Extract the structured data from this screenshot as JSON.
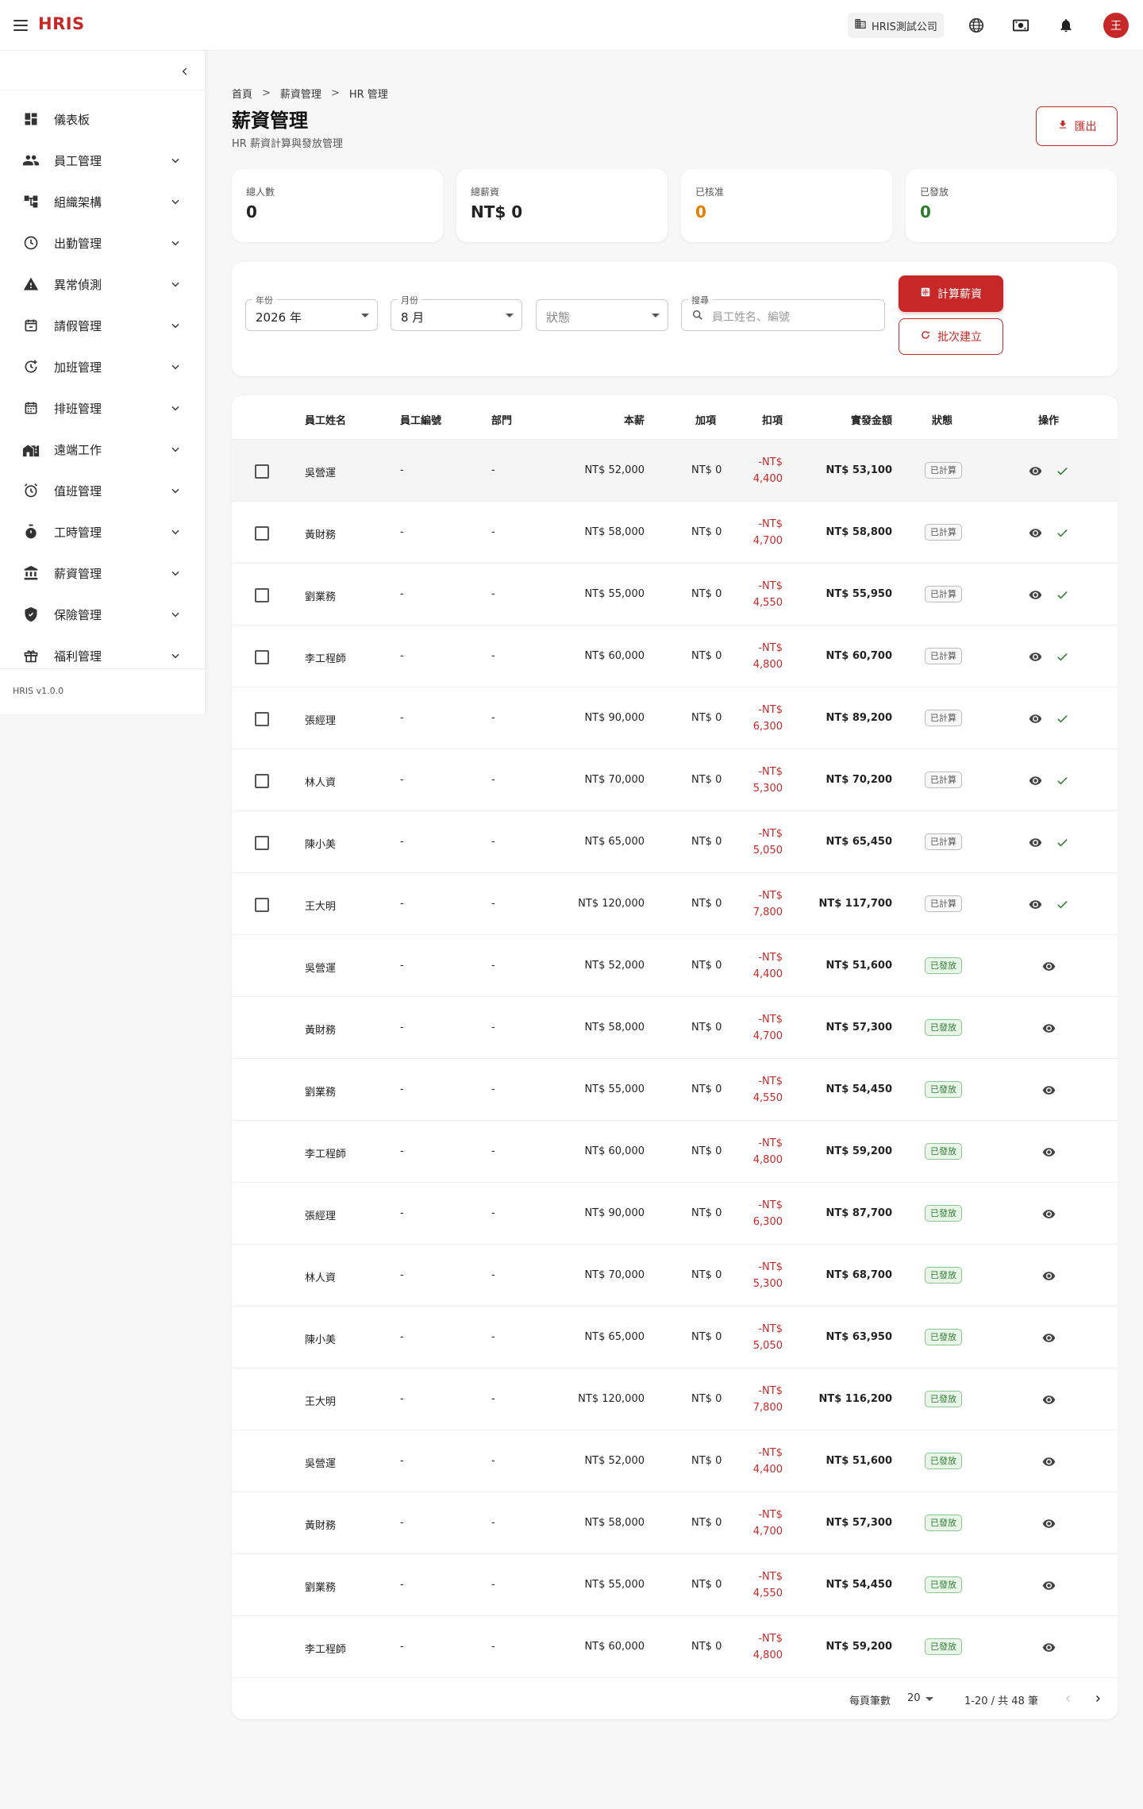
{
  "app": {
    "logo": "HRIS",
    "company": "HRIS測試公司",
    "avatar_initial": "王",
    "version": "HRIS v1.0.0",
    "accent": "#c62828"
  },
  "topbar_icons": [
    "menu-icon",
    "building-icon",
    "globe-icon",
    "currency-icon",
    "bell-icon"
  ],
  "sidebar": {
    "items": [
      {
        "label": "儀表板",
        "icon": "dashboard-icon",
        "expandable": false
      },
      {
        "label": "員工管理",
        "icon": "people-icon",
        "expandable": true
      },
      {
        "label": "組織架構",
        "icon": "org-chart-icon",
        "expandable": true
      },
      {
        "label": "出勤管理",
        "icon": "clock-icon",
        "expandable": true
      },
      {
        "label": "異常偵測",
        "icon": "warning-icon",
        "expandable": true
      },
      {
        "label": "請假管理",
        "icon": "calendar-leave-icon",
        "expandable": true
      },
      {
        "label": "加班管理",
        "icon": "overtime-icon",
        "expandable": true
      },
      {
        "label": "排班管理",
        "icon": "schedule-icon",
        "expandable": true
      },
      {
        "label": "遠端工作",
        "icon": "home-work-icon",
        "expandable": true
      },
      {
        "label": "值班管理",
        "icon": "alarm-icon",
        "expandable": true
      },
      {
        "label": "工時管理",
        "icon": "timer-icon",
        "expandable": true
      },
      {
        "label": "薪資管理",
        "icon": "bank-icon",
        "expandable": true
      },
      {
        "label": "保險管理",
        "icon": "shield-icon",
        "expandable": true
      },
      {
        "label": "福利管理",
        "icon": "gift-icon",
        "expandable": true
      }
    ]
  },
  "breadcrumb": {
    "items": [
      "首頁",
      "薪資管理",
      "HR 管理"
    ],
    "separator": ">"
  },
  "page": {
    "title": "薪資管理",
    "subtitle": "HR 薪資計算與發放管理",
    "export_label": "匯出"
  },
  "stats": [
    {
      "label": "總人數",
      "value": "0",
      "color": "#222222"
    },
    {
      "label": "總薪資",
      "value": "NT$ 0",
      "color": "#222222"
    },
    {
      "label": "已核准",
      "value": "0",
      "color": "#e67e00"
    },
    {
      "label": "已發放",
      "value": "0",
      "color": "#2e7d32"
    }
  ],
  "filters": {
    "year": {
      "label": "年份",
      "value": "2026 年"
    },
    "month": {
      "label": "月份",
      "value": "8 月"
    },
    "status": {
      "placeholder": "狀態"
    },
    "search": {
      "label": "搜尋",
      "placeholder": "員工姓名、編號"
    },
    "calc_label": "計算薪資",
    "batch_label": "批次建立"
  },
  "table": {
    "headers": {
      "name": "員工姓名",
      "empno": "員工編號",
      "dept": "部門",
      "base": "本薪",
      "add": "加項",
      "ded": "扣項",
      "net": "實發金額",
      "status": "狀態",
      "ops": "操作"
    },
    "rows": [
      {
        "name": "吳營運",
        "empno": "-",
        "dept": "-",
        "base": "NT$ 52,000",
        "add": "NT$ 0",
        "ded1": "-NT$",
        "ded2": "4,400",
        "net": "NT$ 53,100",
        "status": "已計算",
        "kind": "calc"
      },
      {
        "name": "黃財務",
        "empno": "-",
        "dept": "-",
        "base": "NT$ 58,000",
        "add": "NT$ 0",
        "ded1": "-NT$",
        "ded2": "4,700",
        "net": "NT$ 58,800",
        "status": "已計算",
        "kind": "calc"
      },
      {
        "name": "劉業務",
        "empno": "-",
        "dept": "-",
        "base": "NT$ 55,000",
        "add": "NT$ 0",
        "ded1": "-NT$",
        "ded2": "4,550",
        "net": "NT$ 55,950",
        "status": "已計算",
        "kind": "calc"
      },
      {
        "name": "李工程師",
        "empno": "-",
        "dept": "-",
        "base": "NT$ 60,000",
        "add": "NT$ 0",
        "ded1": "-NT$",
        "ded2": "4,800",
        "net": "NT$ 60,700",
        "status": "已計算",
        "kind": "calc"
      },
      {
        "name": "張經理",
        "empno": "-",
        "dept": "-",
        "base": "NT$ 90,000",
        "add": "NT$ 0",
        "ded1": "-NT$",
        "ded2": "6,300",
        "net": "NT$ 89,200",
        "status": "已計算",
        "kind": "calc"
      },
      {
        "name": "林人資",
        "empno": "-",
        "dept": "-",
        "base": "NT$ 70,000",
        "add": "NT$ 0",
        "ded1": "-NT$",
        "ded2": "5,300",
        "net": "NT$ 70,200",
        "status": "已計算",
        "kind": "calc"
      },
      {
        "name": "陳小美",
        "empno": "-",
        "dept": "-",
        "base": "NT$ 65,000",
        "add": "NT$ 0",
        "ded1": "-NT$",
        "ded2": "5,050",
        "net": "NT$ 65,450",
        "status": "已計算",
        "kind": "calc"
      },
      {
        "name": "王大明",
        "empno": "-",
        "dept": "-",
        "base": "NT$ 120,000",
        "add": "NT$ 0",
        "ded1": "-NT$",
        "ded2": "7,800",
        "net": "NT$ 117,700",
        "status": "已計算",
        "kind": "calc"
      },
      {
        "name": "吳營運",
        "empno": "-",
        "dept": "-",
        "base": "NT$ 52,000",
        "add": "NT$ 0",
        "ded1": "-NT$",
        "ded2": "4,400",
        "net": "NT$ 51,600",
        "status": "已發放",
        "kind": "paid"
      },
      {
        "name": "黃財務",
        "empno": "-",
        "dept": "-",
        "base": "NT$ 58,000",
        "add": "NT$ 0",
        "ded1": "-NT$",
        "ded2": "4,700",
        "net": "NT$ 57,300",
        "status": "已發放",
        "kind": "paid"
      },
      {
        "name": "劉業務",
        "empno": "-",
        "dept": "-",
        "base": "NT$ 55,000",
        "add": "NT$ 0",
        "ded1": "-NT$",
        "ded2": "4,550",
        "net": "NT$ 54,450",
        "status": "已發放",
        "kind": "paid"
      },
      {
        "name": "李工程師",
        "empno": "-",
        "dept": "-",
        "base": "NT$ 60,000",
        "add": "NT$ 0",
        "ded1": "-NT$",
        "ded2": "4,800",
        "net": "NT$ 59,200",
        "status": "已發放",
        "kind": "paid"
      },
      {
        "name": "張經理",
        "empno": "-",
        "dept": "-",
        "base": "NT$ 90,000",
        "add": "NT$ 0",
        "ded1": "-NT$",
        "ded2": "6,300",
        "net": "NT$ 87,700",
        "status": "已發放",
        "kind": "paid"
      },
      {
        "name": "林人資",
        "empno": "-",
        "dept": "-",
        "base": "NT$ 70,000",
        "add": "NT$ 0",
        "ded1": "-NT$",
        "ded2": "5,300",
        "net": "NT$ 68,700",
        "status": "已發放",
        "kind": "paid"
      },
      {
        "name": "陳小美",
        "empno": "-",
        "dept": "-",
        "base": "NT$ 65,000",
        "add": "NT$ 0",
        "ded1": "-NT$",
        "ded2": "5,050",
        "net": "NT$ 63,950",
        "status": "已發放",
        "kind": "paid"
      },
      {
        "name": "王大明",
        "empno": "-",
        "dept": "-",
        "base": "NT$ 120,000",
        "add": "NT$ 0",
        "ded1": "-NT$",
        "ded2": "7,800",
        "net": "NT$ 116,200",
        "status": "已發放",
        "kind": "paid"
      },
      {
        "name": "吳營運",
        "empno": "-",
        "dept": "-",
        "base": "NT$ 52,000",
        "add": "NT$ 0",
        "ded1": "-NT$",
        "ded2": "4,400",
        "net": "NT$ 51,600",
        "status": "已發放",
        "kind": "paid"
      },
      {
        "name": "黃財務",
        "empno": "-",
        "dept": "-",
        "base": "NT$ 58,000",
        "add": "NT$ 0",
        "ded1": "-NT$",
        "ded2": "4,700",
        "net": "NT$ 57,300",
        "status": "已發放",
        "kind": "paid"
      },
      {
        "name": "劉業務",
        "empno": "-",
        "dept": "-",
        "base": "NT$ 55,000",
        "add": "NT$ 0",
        "ded1": "-NT$",
        "ded2": "4,550",
        "net": "NT$ 54,450",
        "status": "已發放",
        "kind": "paid"
      },
      {
        "name": "李工程師",
        "empno": "-",
        "dept": "-",
        "base": "NT$ 60,000",
        "add": "NT$ 0",
        "ded1": "-NT$",
        "ded2": "4,800",
        "net": "NT$ 59,200",
        "status": "已發放",
        "kind": "paid"
      }
    ]
  },
  "pagination": {
    "per_page_label": "每頁筆數",
    "per_page": "20",
    "range": "1-20 / 共 48 筆"
  }
}
